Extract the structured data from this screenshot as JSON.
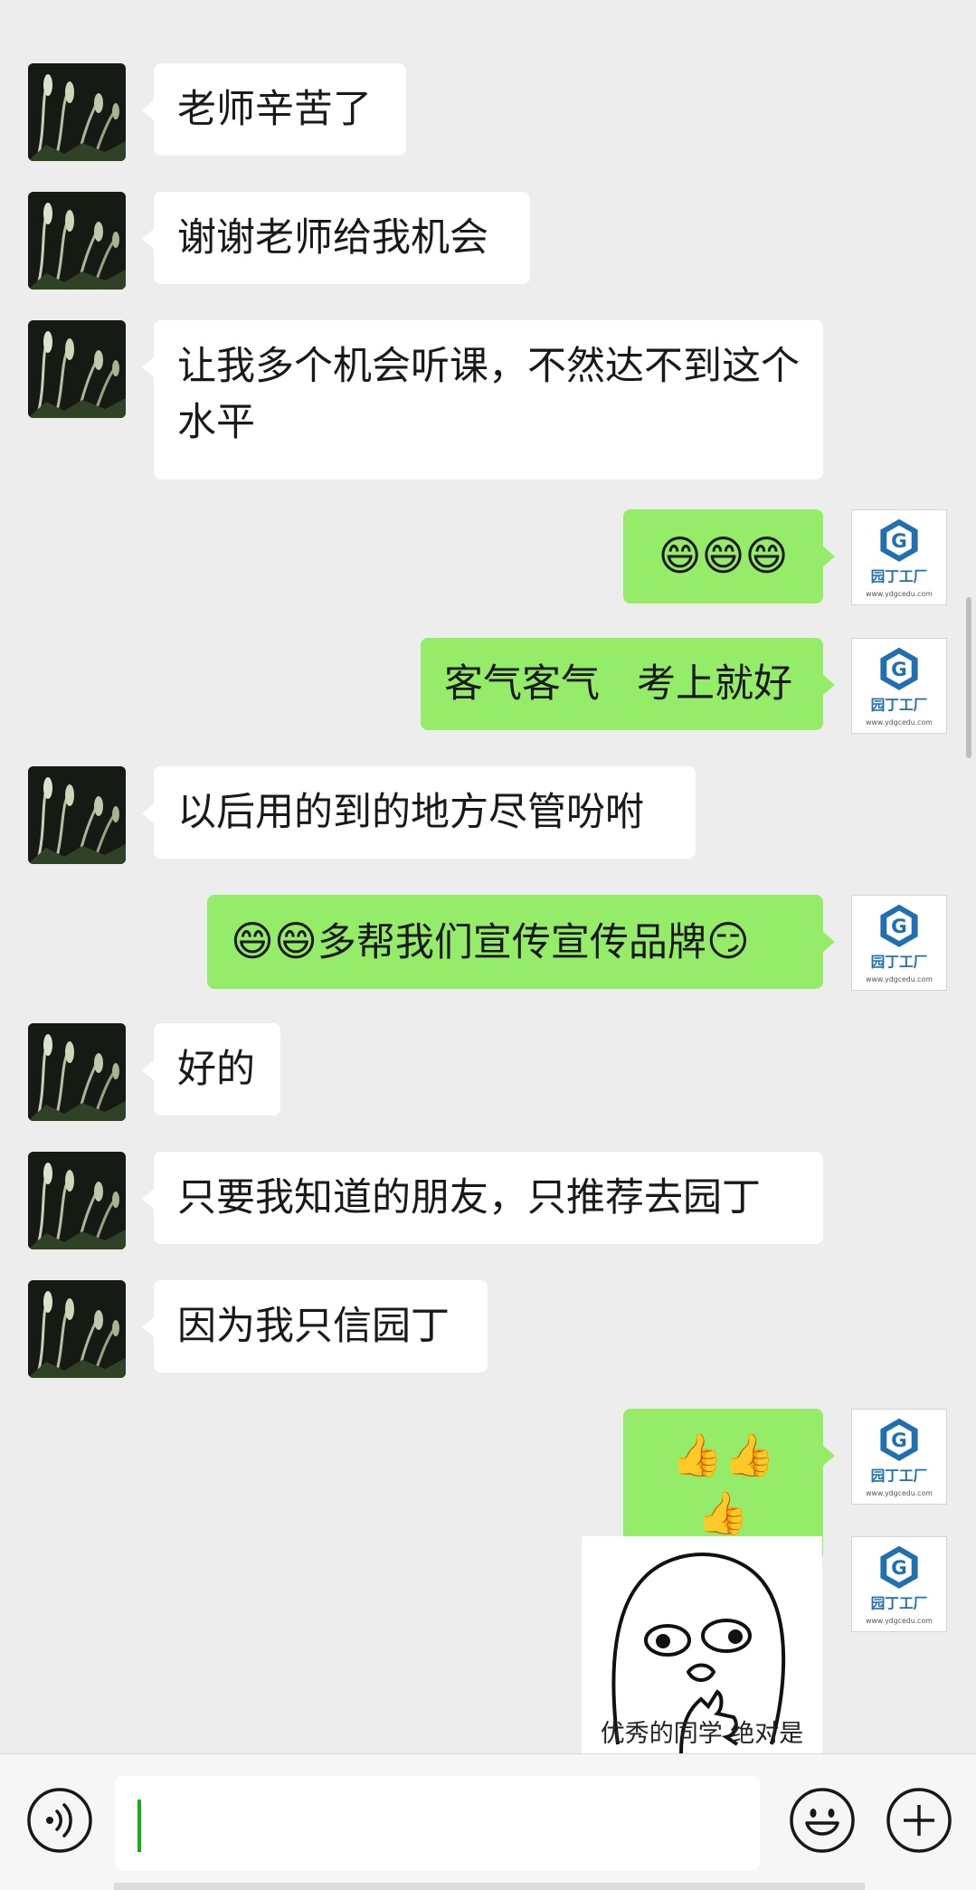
{
  "messages": [
    {
      "side": "left",
      "text": "老师辛苦了"
    },
    {
      "side": "left",
      "text": "谢谢老师给我机会"
    },
    {
      "side": "left",
      "text": "让我多个机会听课，不然达不到这个水平"
    },
    {
      "side": "right",
      "emoji": "😄😄😄"
    },
    {
      "side": "right",
      "text": "客气客气   考上就好"
    },
    {
      "side": "left",
      "text": "以后用的到的地方尽管吩咐"
    },
    {
      "side": "right",
      "emoji_prefix": "😄😄",
      "text": "多帮我们宣传宣传品牌",
      "emoji_suffix": "😏"
    },
    {
      "side": "left",
      "text": "好的"
    },
    {
      "side": "left",
      "text": "只要我知道的朋友，只推荐去园丁"
    },
    {
      "side": "left",
      "text": "因为我只信园丁"
    },
    {
      "side": "right",
      "emoji": "👍👍👍"
    },
    {
      "side": "right",
      "sticker_caption": "优秀的同学 绝对是"
    }
  ],
  "brand": {
    "name": "园丁工厂",
    "url": "www.ydgcedu.com",
    "color": "#1f6fb2"
  },
  "input_bar": {
    "voice_icon": "voice-icon",
    "emoji_icon": "emoji-icon",
    "plus_icon": "plus-icon",
    "text": ""
  }
}
